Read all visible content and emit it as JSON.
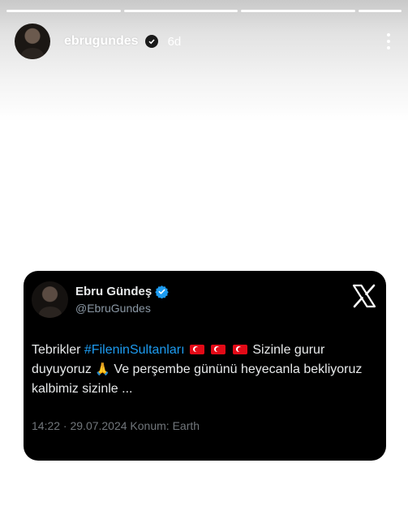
{
  "story": {
    "progress_segments": 4,
    "username": "ebrugundes",
    "time": "6d",
    "icons": {
      "verified": "verified-badge-icon",
      "more": "more-vertical-icon"
    }
  },
  "tweet": {
    "display_name": "Ebru Gündeş",
    "handle": "@EbruGundes",
    "text_part1": "Tebrikler ",
    "hashtag": "#FileninSultanları",
    "text_part2": " Sizinle gurur duyuyoruz ",
    "emoji_hands": "🙏",
    "text_part3": " Ve perşembe gününü heyecanla bekliyoruz kalbimiz sizinle ...",
    "meta": "14:22 · 29.07.2024 Konum: Earth",
    "colors": {
      "hashtag": "#1d9bf0",
      "verified": "#1d9bf0",
      "card_bg": "#000000",
      "meta": "#71767b"
    },
    "icons": {
      "brand": "x-logo-icon",
      "flag": "turkey-flag-icon",
      "verified": "verified-badge-icon"
    }
  }
}
